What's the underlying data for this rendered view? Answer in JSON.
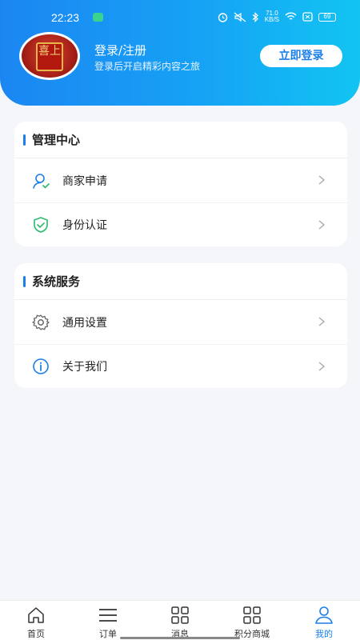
{
  "status_bar": {
    "time": "22:23",
    "speed": "71.0",
    "speed_unit": "KB/S",
    "battery": "69"
  },
  "profile": {
    "avatar_text": "喜上",
    "title": "登录/注册",
    "subtitle": "登录后开启精彩内容之旅",
    "login_button": "立即登录"
  },
  "management": {
    "title": "管理中心",
    "items": [
      {
        "label": "商家申请",
        "icon": "user-icon"
      },
      {
        "label": "身份认证",
        "icon": "shield-check-icon"
      }
    ]
  },
  "system": {
    "title": "系统服务",
    "items": [
      {
        "label": "通用设置",
        "icon": "gear-icon"
      },
      {
        "label": "关于我们",
        "icon": "info-icon"
      }
    ]
  },
  "tabbar": {
    "active": "我的",
    "items": [
      {
        "label": "首页",
        "icon": "home-icon"
      },
      {
        "label": "订单",
        "icon": "list-icon"
      },
      {
        "label": "消息",
        "icon": "grid-icon"
      },
      {
        "label": "积分商城",
        "icon": "grid-icon"
      },
      {
        "label": "我的",
        "icon": "person-icon"
      }
    ]
  },
  "colors": {
    "accent": "#1a7fe8",
    "header_start": "#1b86f2",
    "header_end": "#12c4f2",
    "page_bg": "#f4f6f9"
  }
}
